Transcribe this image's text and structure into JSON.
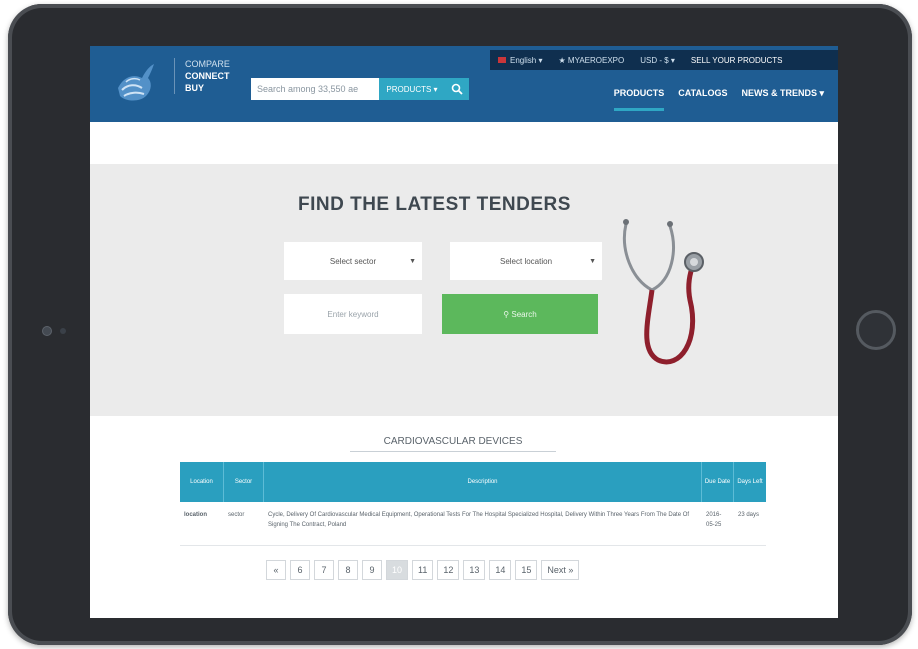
{
  "topbar": {
    "language": "English",
    "myexpo": "MYAEROEXPO",
    "currency": "USD - $",
    "sell": "SELL YOUR PRODUCTS"
  },
  "brand": {
    "line1": "COMPARE",
    "line2": "CONNECT",
    "line3": "BUY"
  },
  "search": {
    "placeholder": "Search among 33,550 ae",
    "category": "PRODUCTS"
  },
  "nav": {
    "items": [
      "PRODUCTS",
      "CATALOGS",
      "NEWS & TRENDS"
    ]
  },
  "hero": {
    "title": "FIND THE LATEST TENDERS",
    "sector_placeholder": "Select sector",
    "location_placeholder": "Select location",
    "keyword_placeholder": "Enter keyword",
    "search_label": "Search"
  },
  "results": {
    "section_title": "CARDIOVASCULAR DEVICES",
    "columns": [
      "Location",
      "Sector",
      "Description",
      "Due Date",
      "Days Left"
    ],
    "rows": [
      {
        "location": "location",
        "sector": "sector",
        "description": "Cycle, Delivery Of Cardiovascular Medical Equipment, Operational Tests For The Hospital Specialized Hospital, Delivery Within Three Years From The Date Of Signing The Contract, Poland",
        "due_date": "2016-05-25",
        "days_left": "23 days"
      }
    ]
  },
  "pagination": {
    "prev": "«",
    "pages": [
      "6",
      "7",
      "8",
      "9",
      "10",
      "11",
      "12",
      "13",
      "14",
      "15"
    ],
    "current": "10",
    "next": "Next »"
  },
  "colors": {
    "header": "#1f5d93",
    "accent": "#2fa7c4",
    "search_button": "#5cb85c",
    "tablet_body": "#2a2c30"
  }
}
